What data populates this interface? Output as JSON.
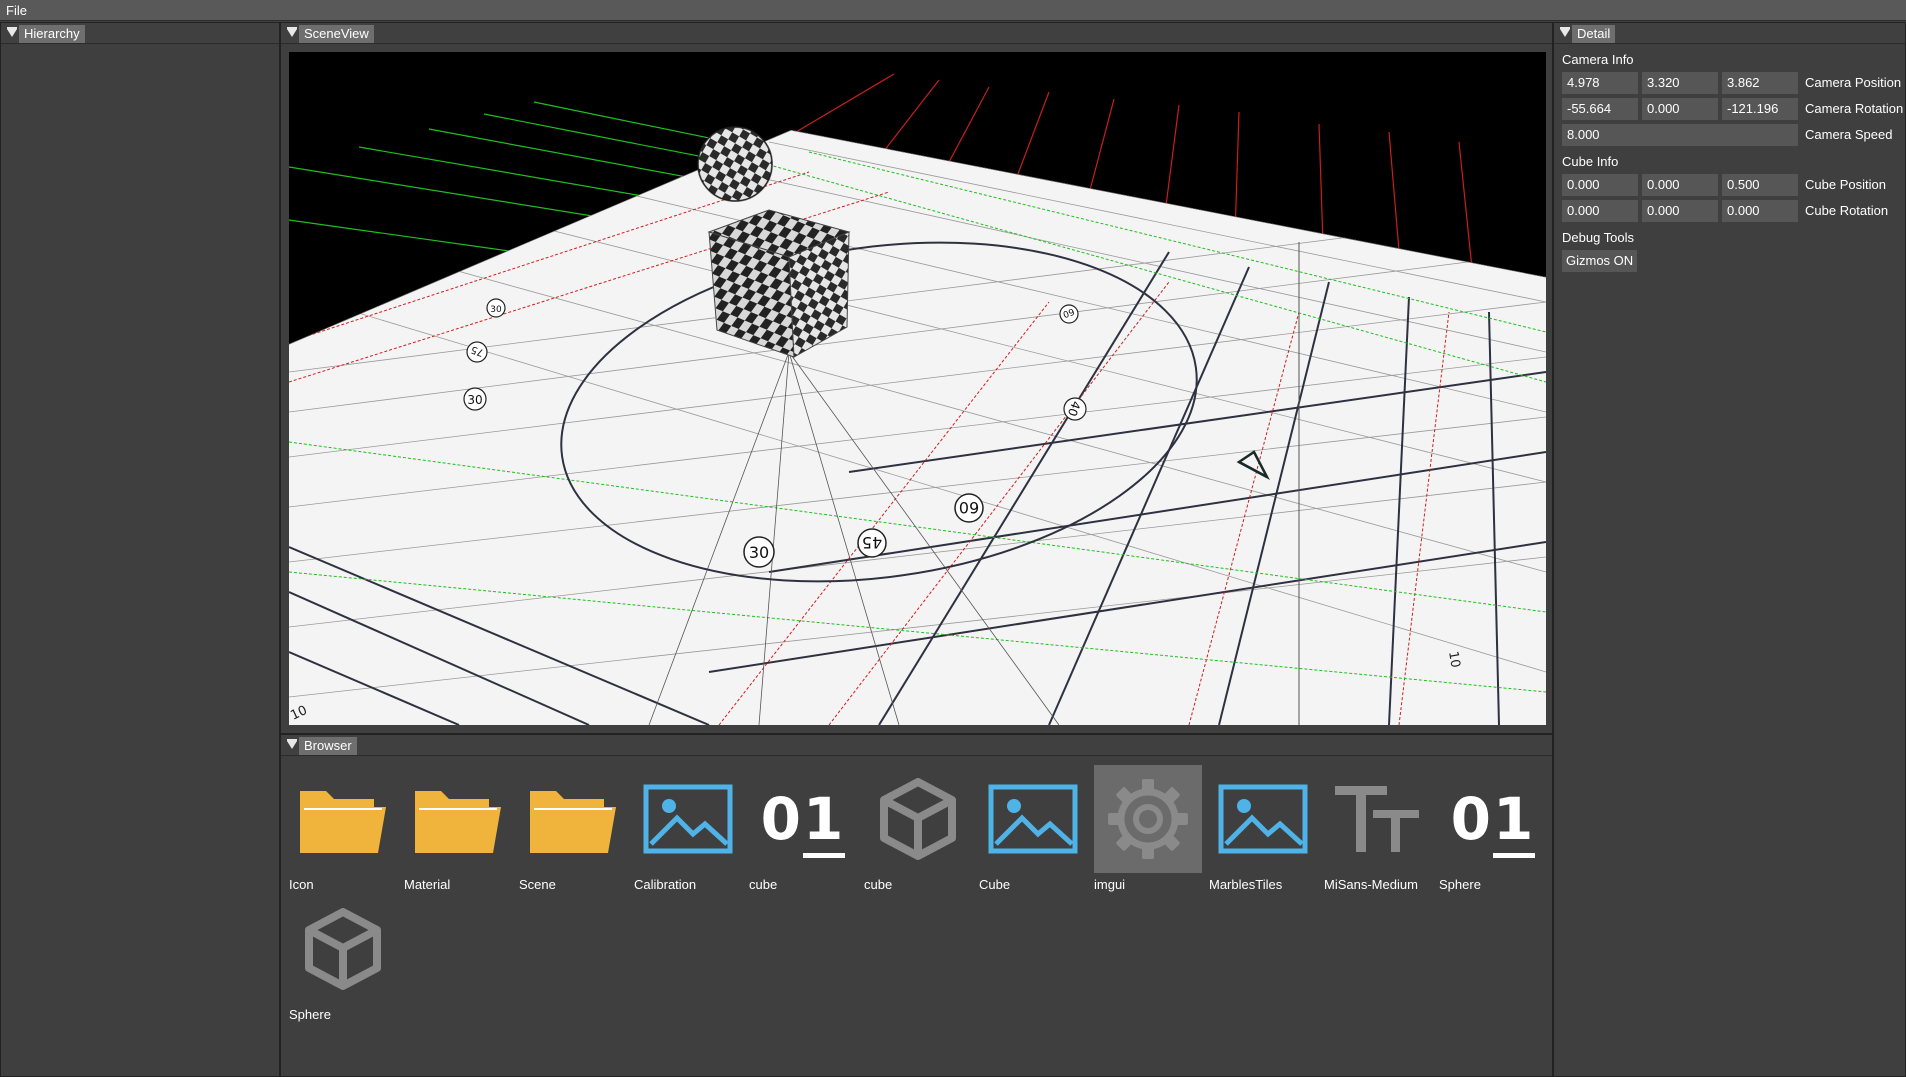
{
  "menubar": {
    "file": "File"
  },
  "panels": {
    "hierarchy": "Hierarchy",
    "sceneview": "SceneView",
    "browser": "Browser",
    "detail": "Detail"
  },
  "browser": {
    "assets": [
      {
        "label": "Icon",
        "icon": "folder-icon"
      },
      {
        "label": "Material",
        "icon": "folder-icon"
      },
      {
        "label": "Scene",
        "icon": "folder-icon"
      },
      {
        "label": "Calibration",
        "icon": "image-icon"
      },
      {
        "label": "cube",
        "icon": "binary-file-icon",
        "glyph": "01"
      },
      {
        "label": "cube",
        "icon": "mesh-cube-icon"
      },
      {
        "label": "Cube",
        "icon": "image-icon"
      },
      {
        "label": "imgui",
        "icon": "gear-icon",
        "selected": true
      },
      {
        "label": "MarblesTiles",
        "icon": "image-icon"
      },
      {
        "label": "MiSans-Medium",
        "icon": "font-icon"
      },
      {
        "label": "Sphere",
        "icon": "binary-file-icon",
        "glyph": "01"
      },
      {
        "label": "Sphere",
        "icon": "mesh-cube-icon"
      }
    ]
  },
  "detail": {
    "camera_info": {
      "title": "Camera Info",
      "position": {
        "x": "4.978",
        "y": "3.320",
        "z": "3.862",
        "label": "Camera Position"
      },
      "rotation": {
        "x": "-55.664",
        "y": "0.000",
        "z": "-121.196",
        "label": "Camera Rotation"
      },
      "speed": {
        "value": "8.000",
        "label": "Camera Speed"
      }
    },
    "cube_info": {
      "title": "Cube Info",
      "position": {
        "x": "0.000",
        "y": "0.000",
        "z": "0.500",
        "label": "Cube Position"
      },
      "rotation": {
        "x": "0.000",
        "y": "0.000",
        "z": "0.000",
        "label": "Cube Rotation"
      }
    },
    "debug_tools": {
      "title": "Debug Tools",
      "gizmos_button": "Gizmos ON"
    }
  },
  "scene": {
    "ring_labels": [
      "30",
      "45",
      "60",
      "40",
      "30",
      "75",
      "60",
      "30"
    ],
    "ruler_labels": [
      "10",
      "10"
    ]
  },
  "colors": {
    "folder": "#f0b43c",
    "image": "#4fb3e8",
    "mesh": "#8a8a8a",
    "grid_green": "#1fbf1f",
    "grid_red": "#d01f1f"
  }
}
